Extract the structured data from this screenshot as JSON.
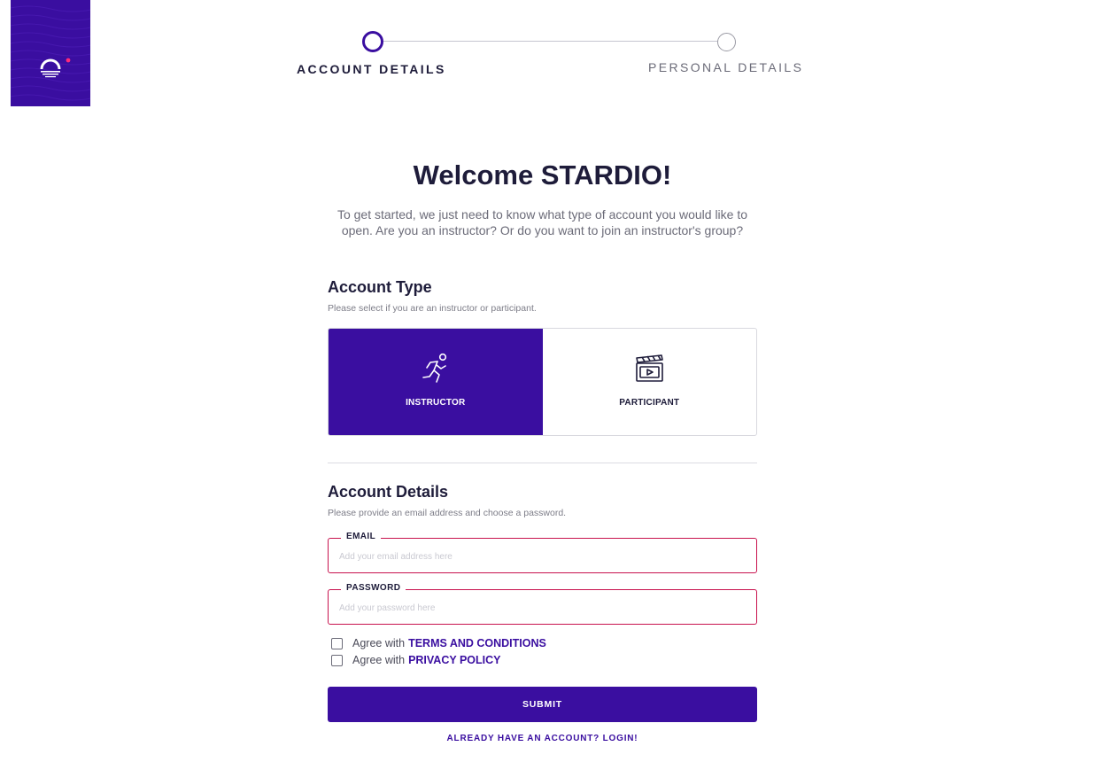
{
  "brand": {
    "logo_icon": "stardio-logo-icon",
    "tile_color": "#3a0ea0",
    "dot_color": "#ff2a7a"
  },
  "stepper": {
    "steps": [
      {
        "label": "ACCOUNT DETAILS",
        "state": "active"
      },
      {
        "label": "PERSONAL DETAILS",
        "state": "inactive"
      }
    ]
  },
  "welcome": {
    "title": "Welcome STARDIO!",
    "intro": "To get started, we just need to know what type of account you would like to open. Are you an instructor? Or do you want to join an instructor's group?"
  },
  "account_type": {
    "title": "Account Type",
    "subtitle": "Please select if you are an instructor or participant.",
    "options": [
      {
        "label": "INSTRUCTOR",
        "icon": "runner-icon",
        "selected": true
      },
      {
        "label": "PARTICIPANT",
        "icon": "clapperboard-icon",
        "selected": false
      }
    ]
  },
  "account_details": {
    "title": "Account Details",
    "subtitle": "Please provide an email address and choose a password.",
    "email": {
      "label": "EMAIL",
      "placeholder": "Add your email address here",
      "value": ""
    },
    "password": {
      "label": "PASSWORD",
      "placeholder": "Add your password here",
      "value": ""
    }
  },
  "agreements": [
    {
      "prefix": "Agree with",
      "link": "TERMS AND CONDITIONS",
      "checked": false
    },
    {
      "prefix": "Agree with",
      "link": "PRIVACY POLICY",
      "checked": false
    }
  ],
  "actions": {
    "submit_label": "SUBMIT",
    "login_label": "ALREADY HAVE AN ACCOUNT? LOGIN!"
  },
  "colors": {
    "primary": "#3a0ea0",
    "error_border": "#c8124e",
    "text_dark": "#1e1c3a"
  }
}
